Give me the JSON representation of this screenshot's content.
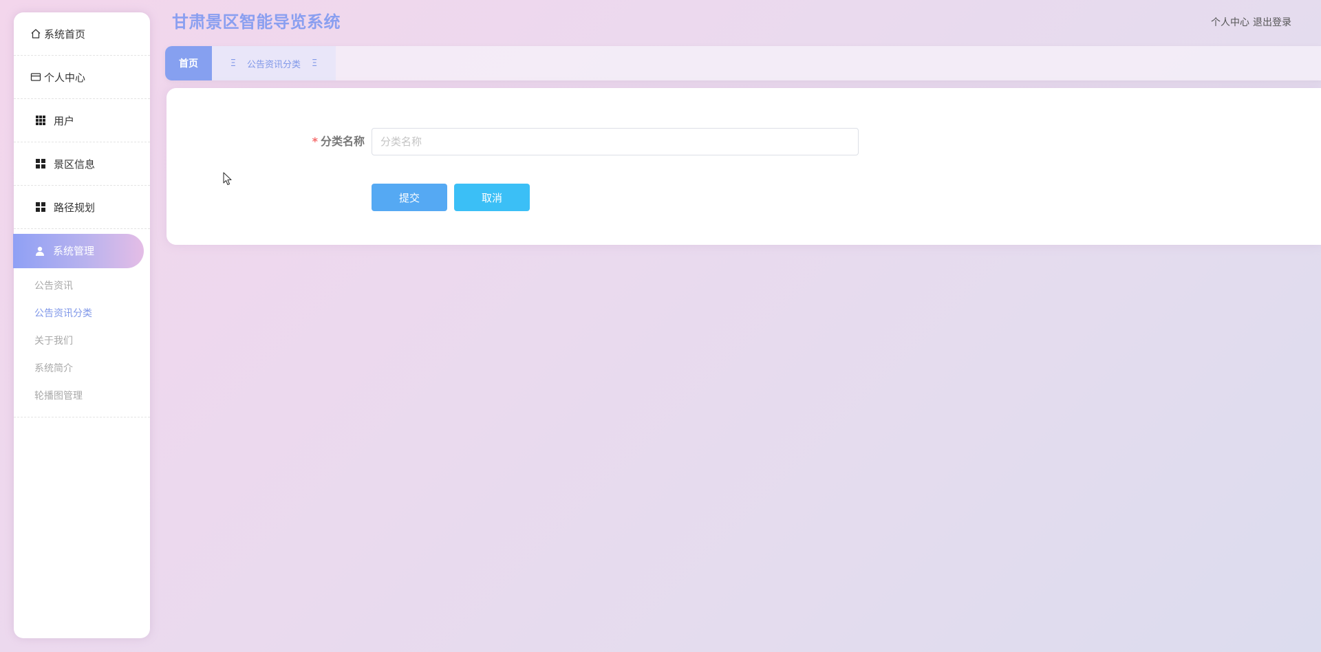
{
  "app": {
    "title": "甘肃景区智能导览系统"
  },
  "header": {
    "personal_center": "个人中心",
    "logout": "退出登录"
  },
  "sidebar": {
    "items": [
      {
        "label": "系统首页",
        "icon": "home-icon"
      },
      {
        "label": "个人中心",
        "icon": "card-icon"
      },
      {
        "label": "用户",
        "icon": "grid-icon"
      },
      {
        "label": "景区信息",
        "icon": "grid-icon"
      },
      {
        "label": "路径规划",
        "icon": "grid-icon"
      }
    ],
    "active_group": {
      "label": "系统管理",
      "icon": "user-icon",
      "children": [
        {
          "label": "公告资讯",
          "active": false
        },
        {
          "label": "公告资讯分类",
          "active": true
        },
        {
          "label": "关于我们",
          "active": false
        },
        {
          "label": "系统简介",
          "active": false
        },
        {
          "label": "轮播图管理",
          "active": false
        }
      ]
    }
  },
  "tabs": {
    "home": "首页",
    "current": "公告资讯分类",
    "glyph": "Ξ"
  },
  "form": {
    "required_mark": "*",
    "category_label": "分类名称",
    "category_value": "",
    "category_placeholder": "分类名称",
    "submit": "提交",
    "cancel": "取消"
  },
  "colors": {
    "accent": "#86a0f0",
    "title": "#8a9ff0",
    "submit_button": "#55a9f3",
    "cancel_button": "#3bbff6",
    "required": "#f56c6c"
  }
}
